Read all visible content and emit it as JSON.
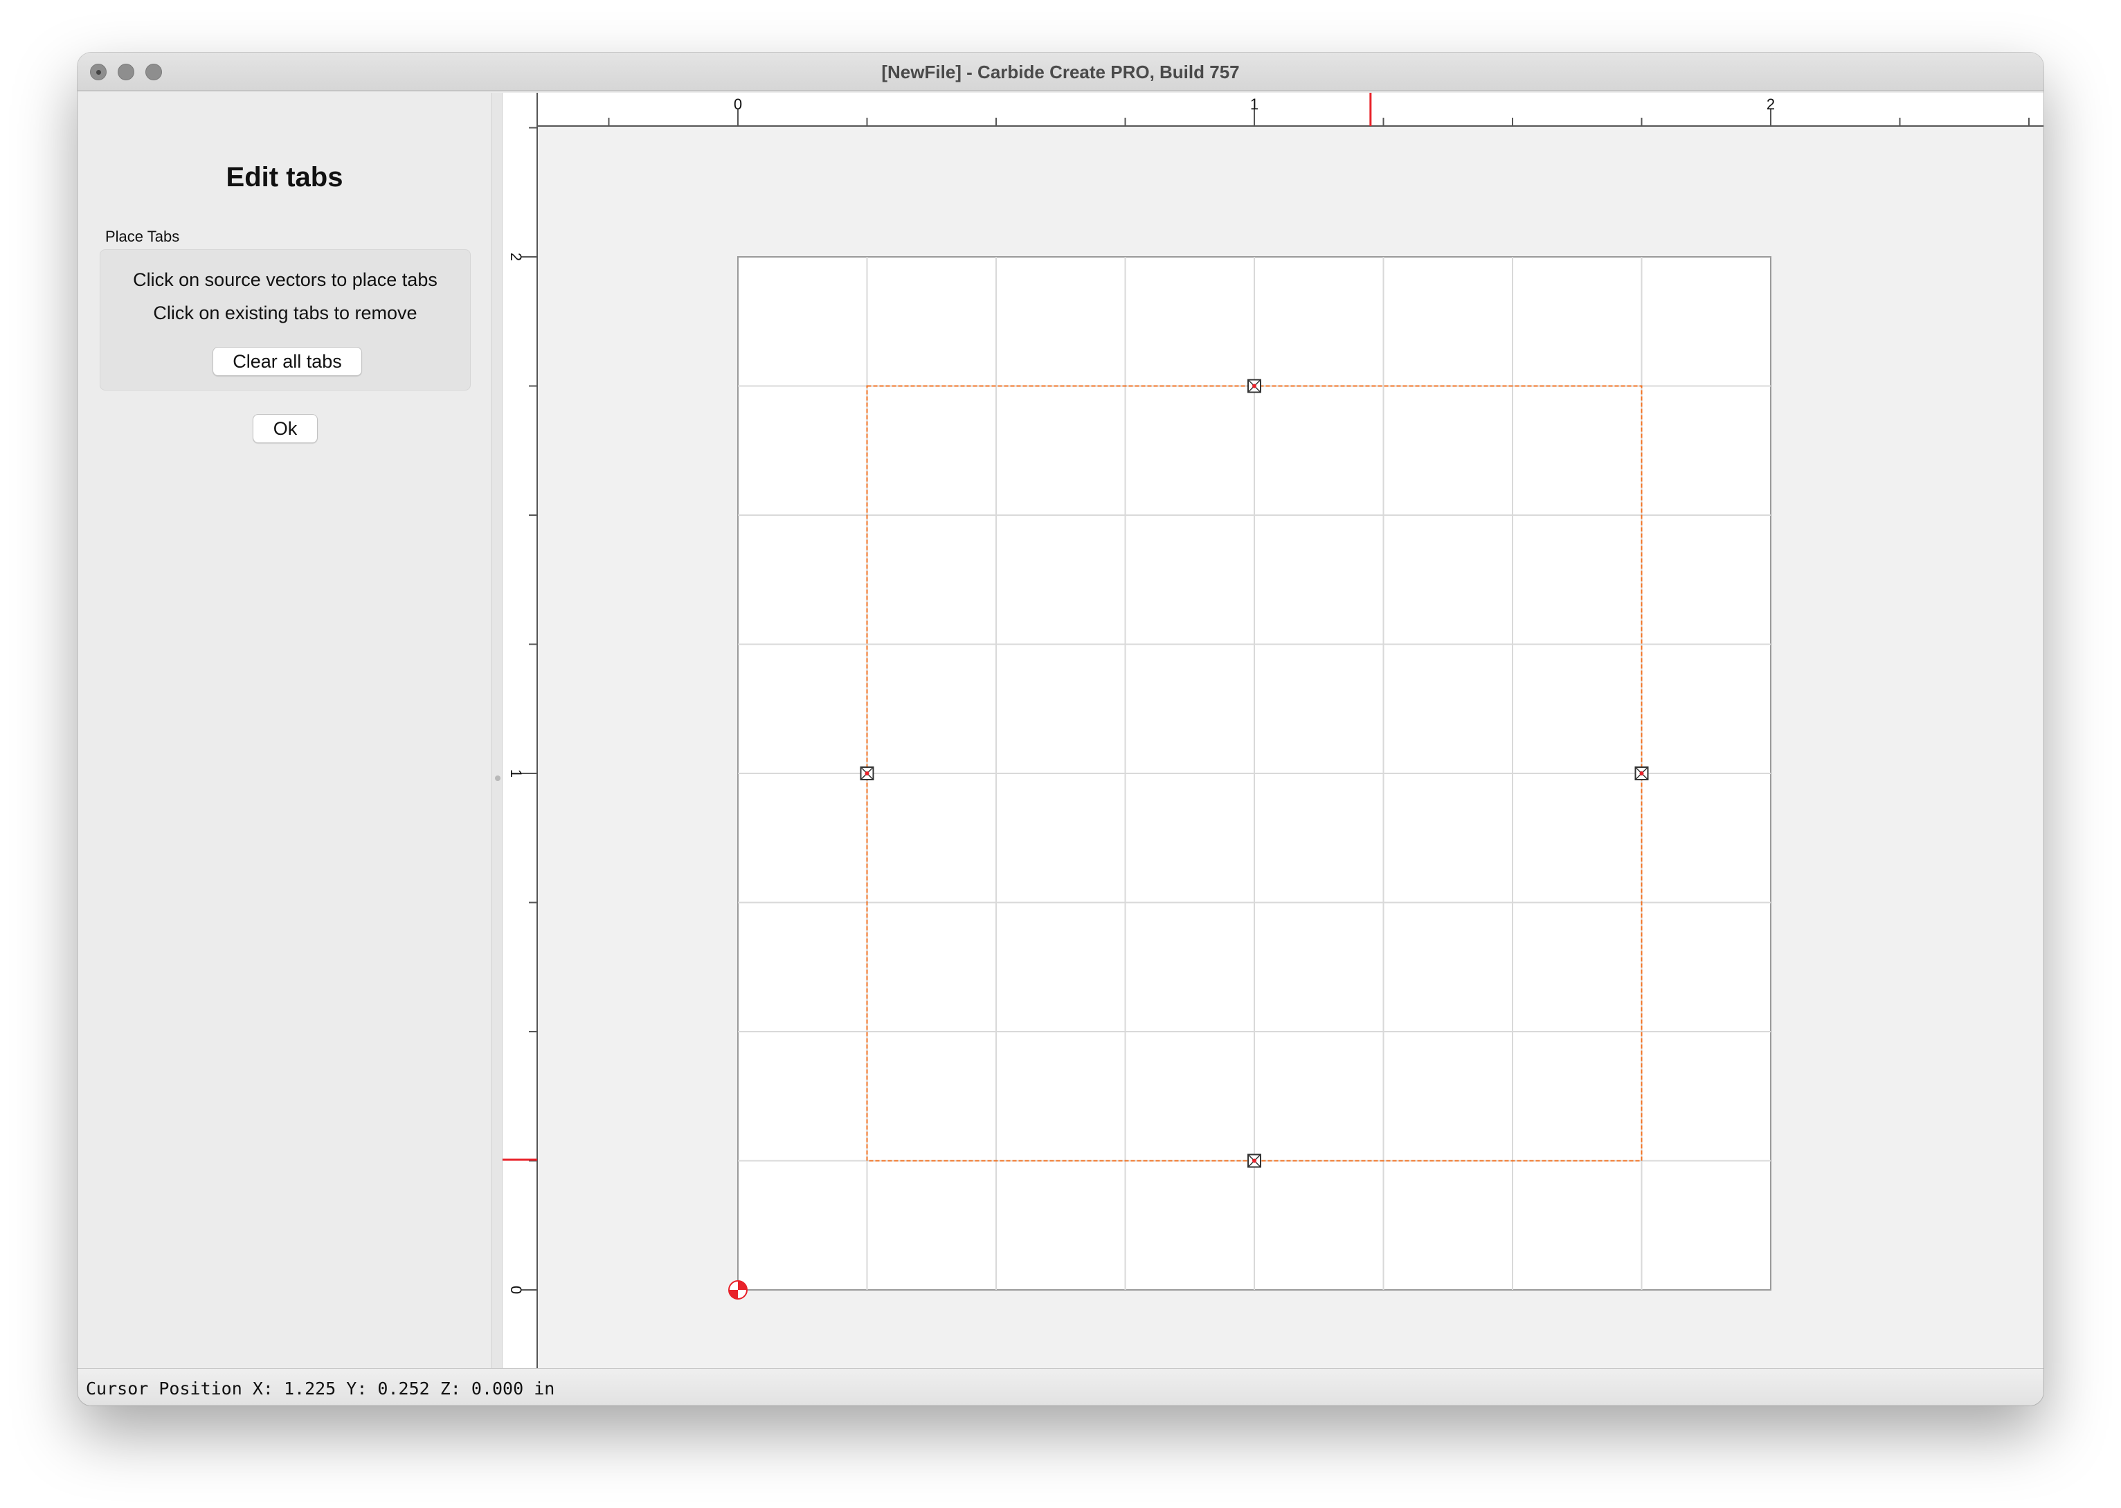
{
  "window": {
    "title": "[NewFile] - Carbide Create PRO, Build 757"
  },
  "panel": {
    "title": "Edit tabs",
    "group_label": "Place Tabs",
    "hint_place": "Click on source vectors to place tabs",
    "hint_remove": "Click on existing tabs to remove",
    "clear_button": "Clear all tabs",
    "ok_button": "Ok"
  },
  "rulers": {
    "horizontal_labels": [
      "0",
      "1",
      "2"
    ],
    "vertical_labels": [
      "2",
      "1",
      "0"
    ]
  },
  "design": {
    "units": "in",
    "stock": {
      "x": [
        0,
        2.0
      ],
      "y": [
        0,
        2.0
      ]
    },
    "grid_step": 0.25,
    "rectangle": {
      "x": [
        0.25,
        1.75
      ],
      "y": [
        0.25,
        1.75
      ]
    },
    "tabs": [
      {
        "x": 1.0,
        "y": 1.75
      },
      {
        "x": 0.25,
        "y": 1.0
      },
      {
        "x": 1.75,
        "y": 1.0
      },
      {
        "x": 1.0,
        "y": 0.25
      }
    ],
    "cursor_x": 1.225,
    "cursor_y": 0.252,
    "colors": {
      "vector": "#f07020",
      "cursor_marker": "#e8222a",
      "origin": "#e8222a",
      "grid": "#d9d9d9"
    }
  },
  "status": {
    "cursor_text": "Cursor Position X: 1.225 Y: 0.252 Z: 0.000 in"
  }
}
